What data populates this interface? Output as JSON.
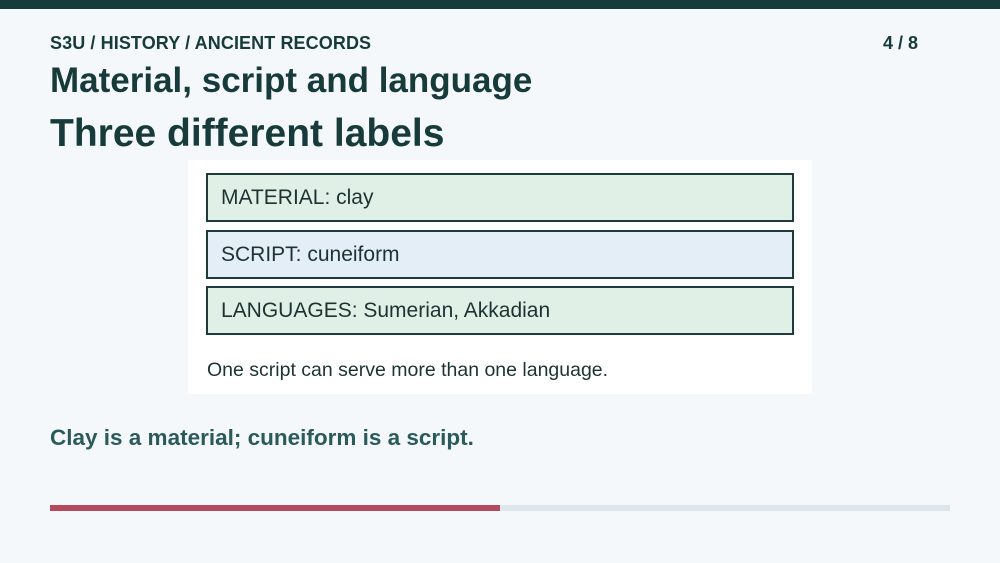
{
  "header": {
    "breadcrumb": "S3U / HISTORY / ANCIENT RECORDS",
    "page_counter": "4 / 8",
    "title": "Material, script and language",
    "subtitle": "Three different labels"
  },
  "card": {
    "labels": [
      {
        "text": "MATERIAL: clay",
        "color": "#e0f0e6"
      },
      {
        "text": "SCRIPT: cuneiform",
        "color": "#e3eef7"
      },
      {
        "text": "LANGUAGES: Sumerian, Akkadian",
        "color": "#e0f0e6"
      }
    ],
    "note": "One script can serve more than one language."
  },
  "takeaway": "Clay is a material; cuneiform is a script.",
  "progress": {
    "fraction": 0.5,
    "fill_color": "#b44a5e",
    "track_color": "#dde6ea"
  },
  "colors": {
    "top_bar": "#173a3a",
    "background": "#f4f8fb",
    "text_dark": "#173a3a",
    "takeaway_text": "#2b5a5a"
  }
}
